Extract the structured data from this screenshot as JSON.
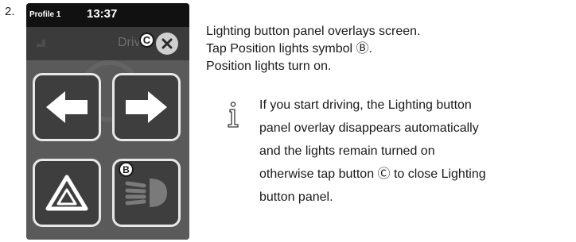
{
  "step": {
    "number": "2."
  },
  "device": {
    "profile_label": "Profile 1",
    "clock": "13:37",
    "header_title": "Drive",
    "callout_close": "C",
    "callout_lights": "B",
    "buttons": {
      "left": {
        "icon": "arrow-left-icon"
      },
      "right": {
        "icon": "arrow-right-icon"
      },
      "hazard": {
        "icon": "hazard-triangle-icon"
      },
      "lights": {
        "icon": "position-lights-icon"
      },
      "close": {
        "icon": "close-icon"
      }
    },
    "colors": {
      "screen_bg": "#1e1e1e",
      "panel_bg": "#5a5a5a",
      "button_bg": "#3e3e3e",
      "button_border": "#e8e8e8"
    }
  },
  "instructions": {
    "lines": [
      "Lighting button panel overlays screen.",
      "Tap Position lights symbol Ⓑ.",
      "Position lights turn on."
    ]
  },
  "note": {
    "icon": "info-icon",
    "lines": [
      "If you start driving, the Lighting button",
      "panel overlay disappears automatically",
      "and the lights remain turned on",
      "otherwise tap button Ⓒ to close Lighting",
      "button panel."
    ]
  }
}
